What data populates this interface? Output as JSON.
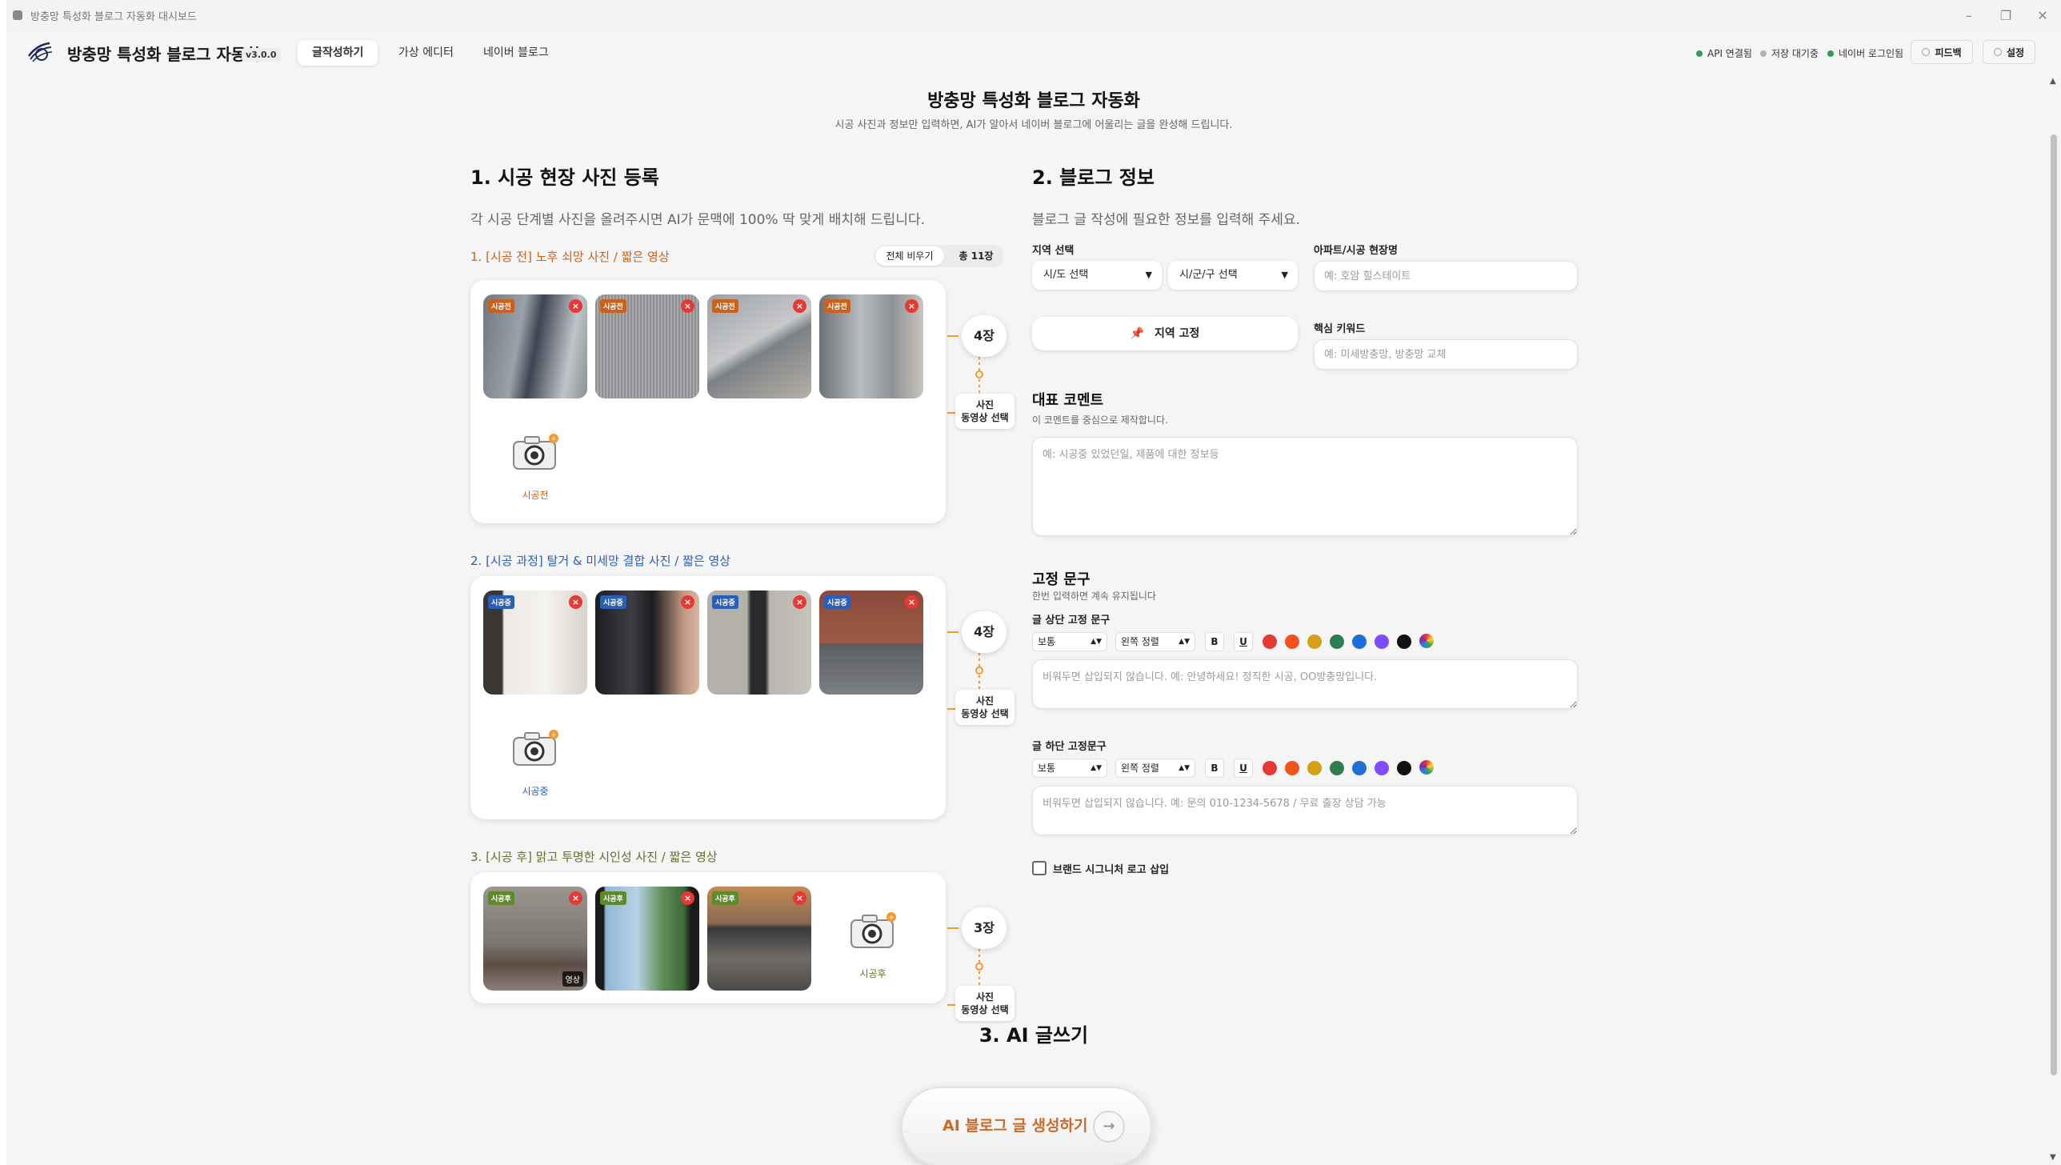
{
  "window": {
    "title": "방충망 특성화 블로그 자동화 대시보드",
    "controls": [
      "–",
      "❐",
      "✕"
    ]
  },
  "header": {
    "brand": "방충망 특성화 블로그 자동화",
    "version": "v3.0.0",
    "tabs": [
      {
        "label": "글작성하기",
        "active": true
      },
      {
        "label": "가상 에디터",
        "active": false
      },
      {
        "label": "네이버 블로그",
        "active": false
      }
    ],
    "status": [
      {
        "label": "API 연결됨",
        "color": "#2e9e5b"
      },
      {
        "label": "저장 대기중",
        "color": "#b0b0b0"
      },
      {
        "label": "네이버 로그인됨",
        "color": "#2e9e5b"
      }
    ],
    "feedback_label": "피드백",
    "settings_label": "설정"
  },
  "page": {
    "title": "방충망 특성화 블로그 자동화",
    "subtitle": "시공 사진과 정보만 입력하면, AI가 알아서 네이버 블로그에 어울리는 글을 완성해 드립니다."
  },
  "photos": {
    "title": "1. 시공 현장 사진 등록",
    "desc": "각 시공 단계별 사진을 올려주시면 AI가 문맥에 100% 딱 맞게 배치해 드립니다.",
    "clear_label": "전체 비우기",
    "total_label": "총 11장",
    "stages": [
      {
        "label": "1. [시공 전] 노후 쇠망 사진 / 짧은 영상",
        "badge": "시공전",
        "color": "#c8621e",
        "count_label": "4장",
        "adder_label": "시공전",
        "select_line1": "사진",
        "select_line2": "동영상 선택",
        "photos": [
          {
            "badge": "시공전",
            "video": ""
          },
          {
            "badge": "시공전",
            "video": ""
          },
          {
            "badge": "시공전",
            "video": ""
          },
          {
            "badge": "시공전",
            "video": ""
          }
        ]
      },
      {
        "label": "2. [시공 과정] 탈거 & 미세망 결합 사진 / 짧은 영상",
        "badge": "시공중",
        "color": "#2a5fb8",
        "count_label": "4장",
        "adder_label": "시공중",
        "select_line1": "사진",
        "select_line2": "동영상 선택",
        "photos": [
          {
            "badge": "시공중",
            "video": ""
          },
          {
            "badge": "시공중",
            "video": ""
          },
          {
            "badge": "시공중",
            "video": ""
          },
          {
            "badge": "시공중",
            "video": ""
          }
        ]
      },
      {
        "label": "3. [시공 후] 맑고 투명한 시인성 사진 / 짧은 영상",
        "badge": "시공후",
        "color": "#6b6b2a",
        "count_label": "3장",
        "adder_label": "시공후",
        "select_line1": "사진",
        "select_line2": "동영상 선택",
        "photos": [
          {
            "badge": "시공후",
            "video": "영상"
          },
          {
            "badge": "시공후",
            "video": ""
          },
          {
            "badge": "시공후",
            "video": ""
          }
        ]
      }
    ]
  },
  "blog": {
    "title": "2. 블로그 정보",
    "desc": "블로그 글 작성에 필요한 정보를 입력해 주세요.",
    "region_label": "지역 선택",
    "province_value": "시/도 선택",
    "city_value": "시/군/구 선택",
    "site_label": "아파트/시공 현장명",
    "site_placeholder": "예: 호암 힐스테이트",
    "pin_label": "지역 고정",
    "keyword_label": "핵심 키워드",
    "keyword_placeholder": "예: 미세방충망, 방충망 교체",
    "comment_title": "대표 코멘트",
    "comment_note": "이 코멘트를 중심으로 제작합니다.",
    "comment_placeholder": "예: 시공중 있었던일, 제품에 대한 정보등",
    "fixed_title": "고정 문구",
    "fixed_note": "한번 입력하면 계속 유지됩니다",
    "top_label": "글 상단 고정 문구",
    "top_placeholder": "비워두면 삽입되지 않습니다. 예: 안녕하세요! 정직한 시공, OO방충망입니다.",
    "bottom_label": "글 하단 고정문구",
    "bottom_placeholder": "비워두면 삽입되지 않습니다. 예: 문의 010-1234-5678 / 무료 출장 상담 가능",
    "size_value": "보통",
    "align_value": "왼쪽 정렬",
    "bold_label": "B",
    "underline_label": "U",
    "colors": [
      "#e53935",
      "#f4511e",
      "#d4a017",
      "#2e7d4f",
      "#1e6fd9",
      "#7c4dff",
      "#111111"
    ],
    "logo_checkbox_label": "브랜드 시그니처 로고 삽입"
  },
  "ai": {
    "title": "3. AI 글쓰기",
    "generate_label": "AI 블로그 글 생성하기",
    "arrow": "→"
  }
}
